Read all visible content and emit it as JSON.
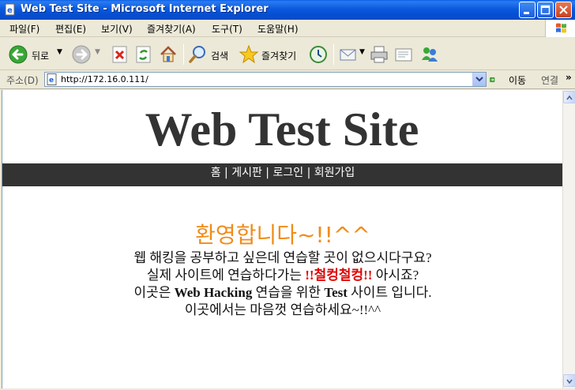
{
  "window": {
    "title": "Web Test Site - Microsoft Internet Explorer"
  },
  "menu": {
    "items": [
      "파일(F)",
      "편집(E)",
      "보기(V)",
      "즐겨찾기(A)",
      "도구(T)",
      "도움말(H)"
    ]
  },
  "toolbar": {
    "back_label": "뒤로",
    "search_label": "검색",
    "favorites_label": "즐겨찾기"
  },
  "address": {
    "label": "주소(D)",
    "url": "http://172.16.0.111/",
    "go_label": "이동",
    "links_label": "연결",
    "more": "»"
  },
  "page": {
    "site_title": "Web Test Site",
    "nav": {
      "home": "홈",
      "board": "게시판",
      "login": "로그인",
      "signup": "회원가입",
      "sep": " | "
    },
    "welcome": "환영합니다~!!^^",
    "line1": "웹 해킹을 공부하고 싶은데 연습할 곳이 없으시다구요?",
    "line2_a": "실제 사이트에 연습하다가는 ",
    "line2_red": "!!철컹철컹!!",
    "line2_b": " 아시죠?",
    "line3_a": "이곳은 ",
    "line3_bold1": "Web Hacking",
    "line3_b": " 연습을 위한 ",
    "line3_bold2": "Test",
    "line3_c": " 사이트 입니다.",
    "line4": "이곳에서는 마음껏 연습하세요~!!^^"
  },
  "colors": {
    "titlebar": "#0A5FE6",
    "nav_bg": "#333333",
    "welcome": "#F08C19",
    "warning": "#E00000"
  }
}
